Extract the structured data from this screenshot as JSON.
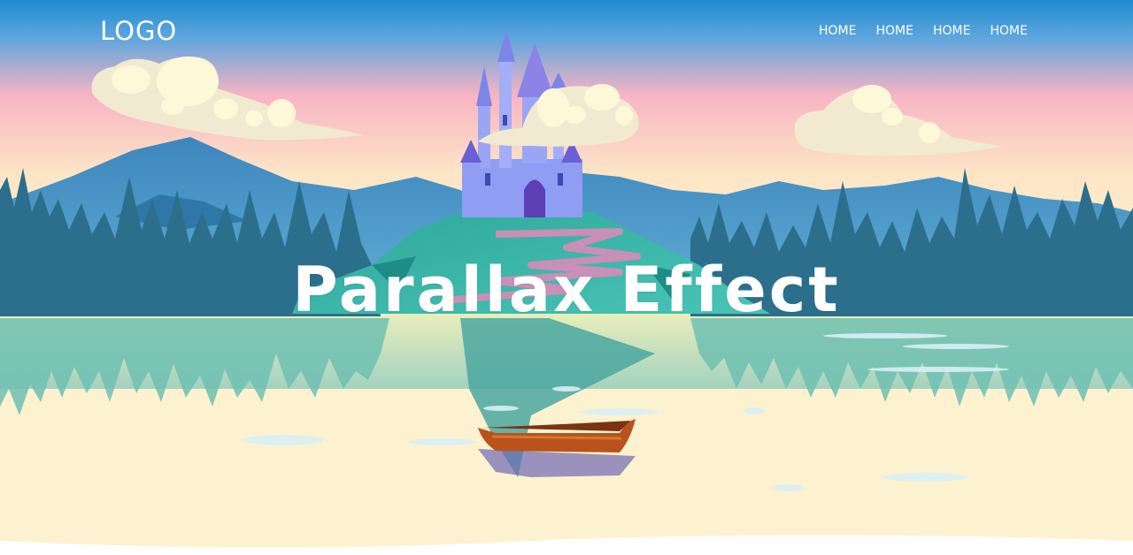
{
  "header": {
    "logo": "LOGO",
    "nav_items": [
      {
        "label": "HOME"
      },
      {
        "label": "HOME"
      },
      {
        "label": "HOME"
      },
      {
        "label": "HOME"
      }
    ]
  },
  "hero": {
    "title": "Parallax Effect"
  },
  "colors": {
    "sky_top": "#1e8bd1",
    "sky_pink": "#f8b4c4",
    "sky_bottom": "#fde9c4",
    "mountain": "#3a8bc0",
    "forest": "#2b6f8d",
    "hill": "#3bb6a8",
    "water_light": "#fdf2cf",
    "boat": "#b9531b",
    "castle": "#8a92ef",
    "cloud": "#fdf8d8"
  },
  "icons": {
    "castle": "castle-illustration",
    "boat": "boat-illustration",
    "cloud": "cloud-illustration"
  }
}
